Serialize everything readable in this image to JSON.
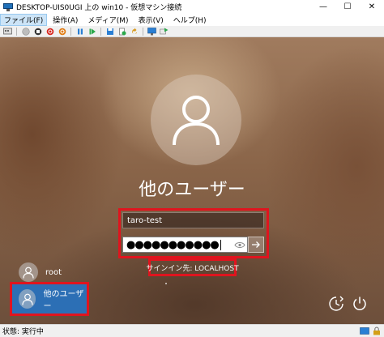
{
  "window": {
    "title": "DESKTOP-UIS0UGI 上の win10 - 仮想マシン接続",
    "minimize_glyph": "—",
    "maximize_glyph": "☐",
    "close_glyph": "✕"
  },
  "menu": {
    "items": [
      {
        "label": "ファイル(F)",
        "active": true
      },
      {
        "label": "操作(A)"
      },
      {
        "label": "メディア(M)"
      },
      {
        "label": "表示(V)"
      },
      {
        "label": "ヘルプ(H)"
      }
    ]
  },
  "toolbar": {
    "icons": [
      "ctrl-alt-del-icon",
      "start-icon",
      "turn-off-icon",
      "shut-down-icon",
      "reset-icon",
      "pause-icon",
      "resume-icon",
      "save-icon",
      "checkpoint-icon",
      "revert-icon",
      "enhanced-session-icon",
      "share-icon"
    ]
  },
  "login": {
    "display_name": "他のユーザー",
    "username_value": "taro-test",
    "password_mask": "●●●●●●●●●●●",
    "sign_in_to": "サインイン先: LOCALHOST",
    "users": [
      {
        "label": "root",
        "selected": false
      },
      {
        "label": "他のユーザー",
        "selected": true
      }
    ]
  },
  "colors": {
    "highlight": "#e0141e",
    "selected_tile": "#2c6fb5"
  },
  "status": {
    "text": "状態: 実行中"
  }
}
